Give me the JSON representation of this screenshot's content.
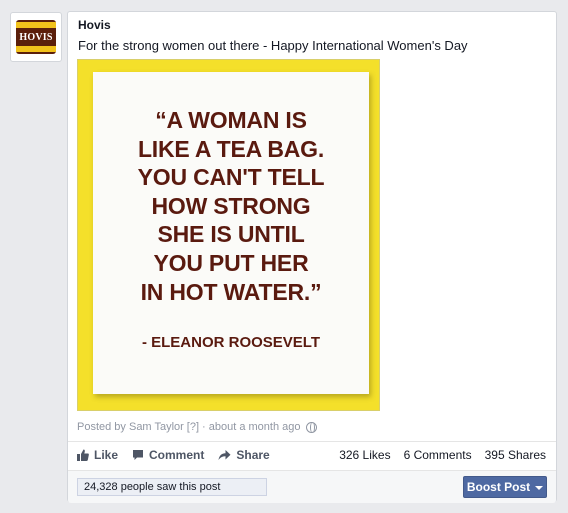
{
  "page": {
    "logo_text": "HOVIS",
    "name": "Hovis"
  },
  "post": {
    "text": "For the strong women out there - Happy International Women's Day",
    "image": {
      "quote_lines": [
        "“A WOMAN IS",
        "LIKE A TEA BAG.",
        "YOU CAN'T TELL",
        "HOW STRONG",
        "SHE IS UNTIL",
        "YOU PUT HER",
        "IN HOT WATER.”"
      ],
      "author": "- ELEANOR ROOSEVELT",
      "colors": {
        "background": "#f4e02a",
        "text": "#5a1a0f"
      }
    },
    "meta": {
      "posted_by": "Posted by Sam Taylor",
      "help_marker": "[?]",
      "time": "· about a month ago",
      "privacy_icon": "globe-icon"
    }
  },
  "actions": {
    "like": "Like",
    "comment": "Comment",
    "share": "Share"
  },
  "stats": {
    "likes": "326 Likes",
    "comments": "6 Comments",
    "shares": "395 Shares"
  },
  "footer": {
    "reach": "24,328 people saw this post",
    "boost_label": "Boost Post",
    "boost_color": "#4e69a2"
  }
}
